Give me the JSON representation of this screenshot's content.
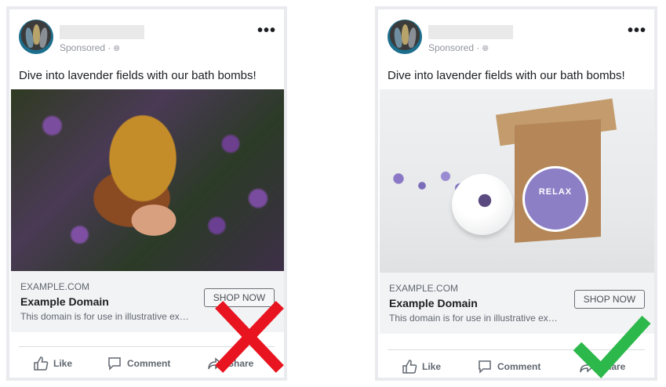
{
  "ads": [
    {
      "sponsored": "Sponsored · ",
      "caption": "Dive into lavender fields with our bath bombs!",
      "link": {
        "domain": "EXAMPLE.COM",
        "headline": "Example Domain",
        "description": "This domain is for use in illustrative ex…",
        "cta": "SHOP NOW"
      },
      "actions": {
        "like": "Like",
        "comment": "Comment",
        "share": "Share"
      },
      "verdict_icon": "red-x-icon"
    },
    {
      "sponsored": "Sponsored · ",
      "caption": "Dive into lavender fields with our bath bombs!",
      "product_label": "RELAX",
      "link": {
        "domain": "EXAMPLE.COM",
        "headline": "Example Domain",
        "description": "This domain is for use in illustrative ex…",
        "cta": "SHOP NOW"
      },
      "actions": {
        "like": "Like",
        "comment": "Comment",
        "share": "Share"
      },
      "verdict_icon": "green-check-icon"
    }
  ],
  "colors": {
    "reject": "#e8141f",
    "approve": "#2db84b",
    "link_bg": "#f2f3f5",
    "text_secondary": "#606770"
  }
}
